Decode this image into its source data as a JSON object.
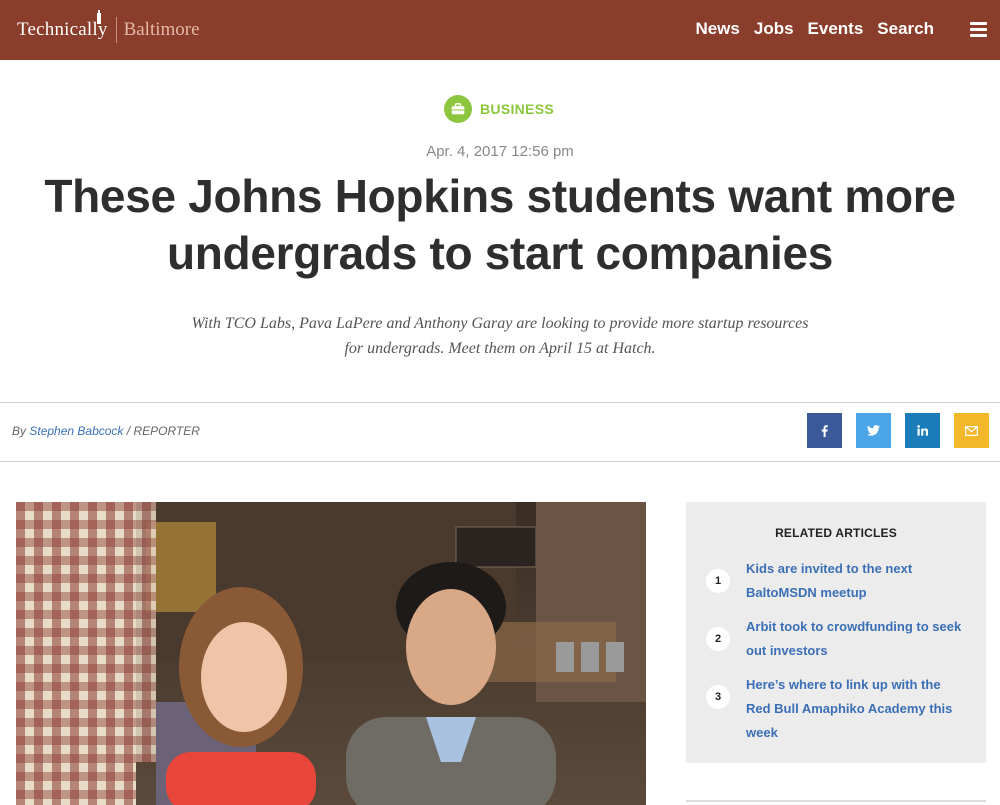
{
  "header": {
    "logo_brand": "Technically",
    "logo_city": "Baltimore",
    "nav": [
      {
        "label": "News"
      },
      {
        "label": "Jobs"
      },
      {
        "label": "Events"
      },
      {
        "label": "Search"
      }
    ],
    "menu_icon": "hamburger-icon",
    "bg_color": "#8a3d2a"
  },
  "article": {
    "category": "BUSINESS",
    "category_icon": "briefcase-icon",
    "category_color": "#8cc63f",
    "date": "Apr. 4, 2017 12:56 pm",
    "headline_line1": "These Johns Hopkins students want more",
    "headline_line2": "undergrads to start companies",
    "dek_line1": "With TCO Labs, Pava LaPere and Anthony Garay are looking to provide more startup resources",
    "dek_line2": "for undergrads. Meet them on April 15 at Hatch.",
    "byline_prefix": "By",
    "author": "Stephen Babcock",
    "role": "/ REPORTER"
  },
  "share": [
    {
      "icon": "facebook-icon",
      "color": "#3b5998"
    },
    {
      "icon": "twitter-icon",
      "color": "#4ca5e6"
    },
    {
      "icon": "linkedin-icon",
      "color": "#1a7cb8"
    },
    {
      "icon": "email-icon",
      "color": "#f3b72a"
    }
  ],
  "related": {
    "title": "RELATED ARTICLES",
    "items": [
      {
        "num": "1",
        "line1": "Kids are invited to the next",
        "line2": "BaltoMSDN meetup"
      },
      {
        "num": "2",
        "line1": "Arbit took to crowdfunding to seek",
        "line2": "out investors"
      },
      {
        "num": "3",
        "line1": "Here’s where to link up with the",
        "line2": "Red Bull Amaphiko Academy this",
        "line3": "week"
      }
    ]
  }
}
